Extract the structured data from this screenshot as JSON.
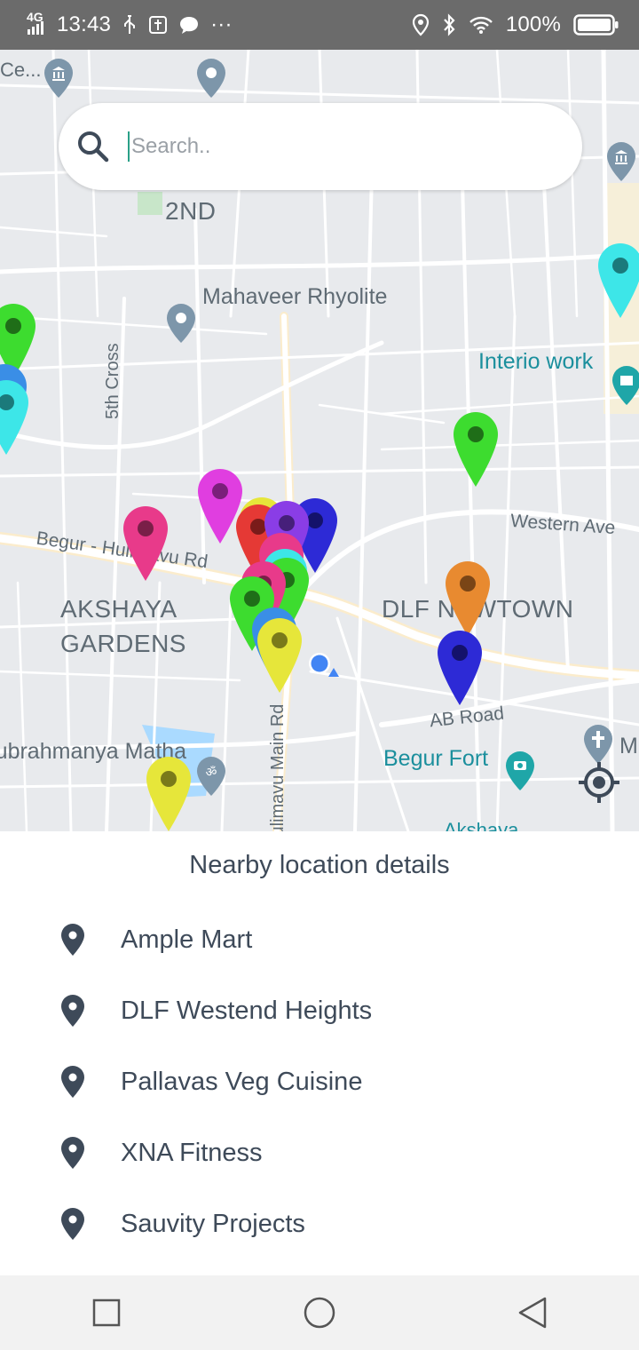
{
  "status_bar": {
    "network": "4G",
    "time": "13:43",
    "more": "···",
    "battery": "100%"
  },
  "search": {
    "placeholder": "Search.."
  },
  "map": {
    "labels": {
      "area_2nd": "2ND",
      "mahaveer": "Mahaveer Rhyolite",
      "interio": "Interio work",
      "cross5": "5th Cross",
      "western": "Western Ave",
      "begur_rd": "Begur - Hulimavu Rd",
      "akshaya": "AKSHAYA\nGARDENS",
      "dlf_newtown": "DLF NEWTOWN",
      "ab_road": "AB Road",
      "subrahmanya": "Subrahmanya Matha",
      "begur_fort": "Begur Fort",
      "main_rd": "Hulimavu Main Rd",
      "akshaya_bottom": "Akshaya",
      "top_left": "Ce...",
      "m_right": "M"
    },
    "pin_colors": {
      "green": "#3ddc2f",
      "cyan": "#3de6e8",
      "blue": "#3a8ee6",
      "magenta": "#e03ee0",
      "pink": "#e83a8a",
      "red": "#e53935",
      "purple": "#8a3de6",
      "navy": "#2d2ad6",
      "orange": "#e88a30",
      "yellow": "#e6e63a"
    }
  },
  "sheet": {
    "title": "Nearby location details",
    "items": [
      {
        "name": "Ample Mart"
      },
      {
        "name": "DLF Westend Heights"
      },
      {
        "name": "Pallavas Veg Cuisine"
      },
      {
        "name": "XNA Fitness"
      },
      {
        "name": "Sauvity Projects"
      }
    ]
  },
  "nav": {
    "recents": "square-icon",
    "home": "circle-icon",
    "back": "triangle-back-icon"
  }
}
